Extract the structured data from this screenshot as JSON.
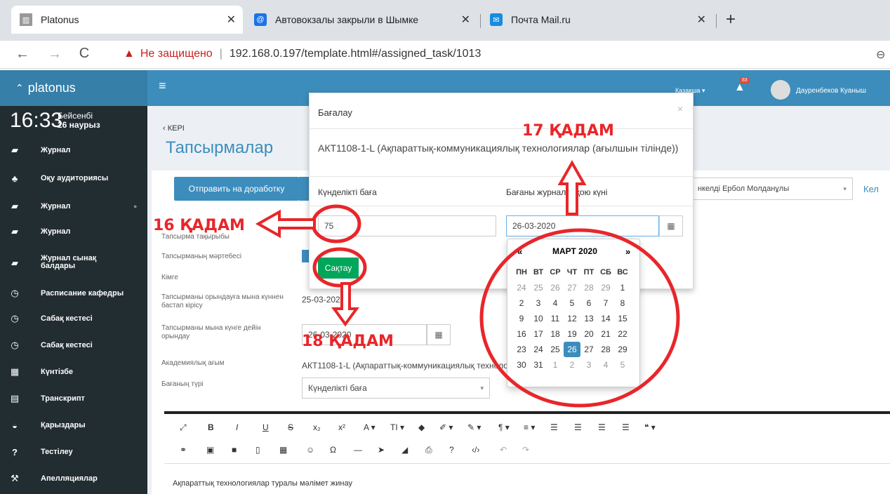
{
  "browser": {
    "tabs": [
      {
        "title": "Platonus",
        "icon": "building-icon"
      },
      {
        "title": "Автовокзалы закрыли в Шымкe",
        "icon": "at-icon"
      },
      {
        "title": "Почта Mail.ru",
        "icon": "mail-icon"
      }
    ],
    "new_tab": "+",
    "security_label": "Не защищено",
    "url": "192.168.0.197/template.html#/assigned_task/1013"
  },
  "header": {
    "logo": "platonus",
    "language": "Қазақша",
    "notification_count": "83",
    "user_name": "Дауренбеков Куаныш"
  },
  "clock": {
    "time": "16:33",
    "weekday": "Бейсенбі",
    "date": "26 наурыз"
  },
  "sidebar": {
    "items": [
      {
        "label": "Журнал",
        "icon": "book-icon"
      },
      {
        "label": "Оқу аудиториясы",
        "icon": "users-icon"
      },
      {
        "label": "Журнал",
        "icon": "book-icon"
      },
      {
        "label": "Журнал",
        "icon": "book-icon"
      },
      {
        "label": "Журнал сынақ балдары",
        "icon": "book-icon"
      },
      {
        "label": "Расписание кафедры",
        "icon": "clock-icon"
      },
      {
        "label": "Сабақ кестесі",
        "icon": "clock-icon"
      },
      {
        "label": "Сабақ кестесі",
        "icon": "clock-icon"
      },
      {
        "label": "Күнтізбе",
        "icon": "calendar-icon"
      },
      {
        "label": "Транскрипт",
        "icon": "table-icon"
      },
      {
        "label": "Қарыздары",
        "icon": "bank-icon"
      },
      {
        "label": "Тестілеу",
        "icon": "question-icon"
      },
      {
        "label": "Апелляциялар",
        "icon": "gavel-icon"
      }
    ]
  },
  "page": {
    "back": "‹ КЕРІ",
    "title": "Тапсырмалар",
    "send_button": "Отправить на доработку",
    "teacher_select": "нкелді Ербол Молданұлы",
    "next_link": "Кел"
  },
  "form": {
    "topic_label": "Тапсырма тақырыбы",
    "status_label": "Тапсырманың мәртебесі",
    "to_label": "Кімге",
    "start_label": "Тапсырманы орындауға мына күннен бастап кірісу",
    "start_value": "25-03-2020",
    "due_label": "Тапсырманы мына күнге дейін орындау",
    "due_value": "26-03-2020",
    "stream_label": "Академиялық ағым",
    "stream_value": "АКТ1108-1-L (Ақпараттық-коммуникациялық технологиялар (ағылшын тілінде))",
    "grade_type_label": "Бағаның түрі",
    "grade_type_value": "Күнделікті баға"
  },
  "editor": {
    "text": "Ақпараттық технологиялар туралы мәлімет жинау"
  },
  "modal": {
    "title": "Бағалау",
    "close": "×",
    "subject": "АКТ1108-1-L (Ақпараттық-коммуникациялық технологиялар (ағылшын тілінде))",
    "grade_label": "Күнделікті баға",
    "grade_value": "75",
    "date_label": "Бағаны журналға қою күні",
    "date_value": "26-03-2020",
    "save_button": "Сақтау"
  },
  "datepicker": {
    "prev": "«",
    "next": "»",
    "month": "МАРТ 2020",
    "weekdays": [
      "ПН",
      "ВТ",
      "СР",
      "ЧТ",
      "ПТ",
      "СБ",
      "ВС"
    ],
    "days": [
      "24",
      "25",
      "26",
      "27",
      "28",
      "29",
      "1",
      "2",
      "3",
      "4",
      "5",
      "6",
      "7",
      "8",
      "9",
      "10",
      "11",
      "12",
      "13",
      "14",
      "15",
      "16",
      "17",
      "18",
      "19",
      "20",
      "21",
      "22",
      "23",
      "24",
      "25",
      "26",
      "27",
      "28",
      "29",
      "30",
      "31",
      "1",
      "2",
      "3",
      "4",
      "5"
    ],
    "selected": "26"
  },
  "annotations": {
    "step16": "16 ҚАДАМ",
    "step17": "17 ҚАДАМ",
    "step18": "18 ҚАДАМ"
  },
  "colors": {
    "annotation": "#e8262a",
    "primary": "#3c8dbc",
    "sidebar": "#222d32",
    "save": "#00a65a"
  }
}
